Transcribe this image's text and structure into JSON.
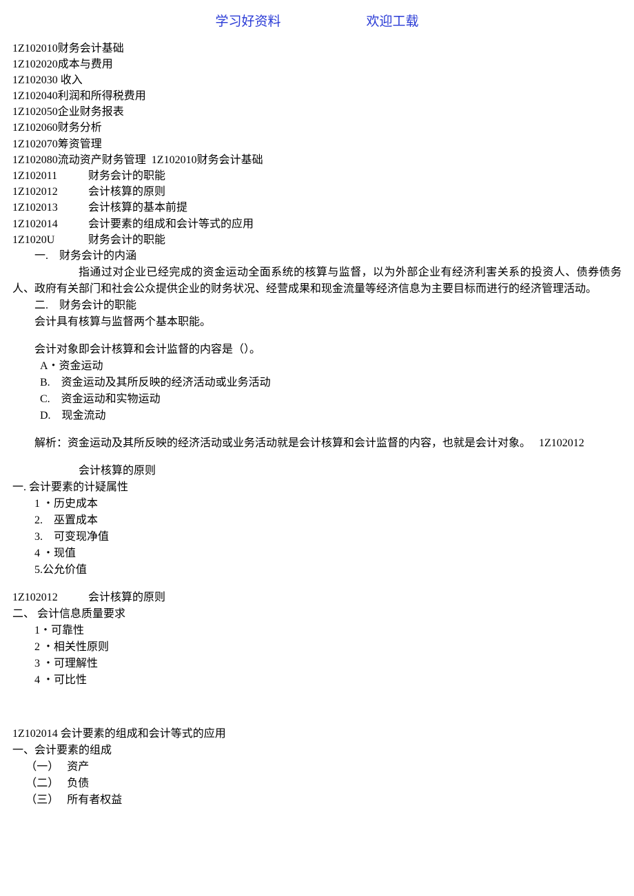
{
  "header": {
    "left": "学习好资料",
    "right": "欢迎工载"
  },
  "toc": [
    {
      "code": "1Z102010",
      "title": "财务会计基础"
    },
    {
      "code": "1Z102020",
      "title": "成本与费用"
    },
    {
      "code": "1Z102030",
      "title": "收入",
      "space": true
    },
    {
      "code": "1Z102040",
      "title": "利润和所得税费用"
    },
    {
      "code": "1Z102050",
      "title": "企业财务报表"
    },
    {
      "code": "1Z102060",
      "title": "财务分析"
    },
    {
      "code": "1Z102070",
      "title": "筹资管理"
    }
  ],
  "toc_last": {
    "code": "1Z102080",
    "title": "流动资产财务管理",
    "extra_code": "1Z102010",
    "extra_title": "财务会计基础"
  },
  "sub": [
    {
      "code": "1Z102011",
      "title": "财务会计的职能"
    },
    {
      "code": "1Z102012",
      "title": "会计核算的原则"
    },
    {
      "code": "1Z102013",
      "title": "会计核算的基本前提"
    },
    {
      "code": "1Z102014",
      "title": "会计要素的组成和会计等式的应用"
    },
    {
      "code": "1Z1020U",
      "title": "财务会计的职能"
    }
  ],
  "section1": {
    "h1": "一.　财务会计的内涵",
    "para": "指通过对企业已经完成的资金运动全面系统的核算与监督，以为外部企业有经济利害关系的投资人、债券债务人、政府有关部门和社会公众提供企业的财务状况、经营成果和现金流量等经济信息为主要目标而进行的经济管理活动。",
    "h2": "二.　财务会计的职能",
    "line": "会计具有核算与监督两个基本职能。"
  },
  "question": {
    "stem": "会计对象即会计核算和会计监督的内容是（）。",
    "opts": [
      "A・资金运动",
      "B.　资金运动及其所反映的经济活动或业务活动",
      "C.　资金运动和实物运动",
      "D.　现金流动"
    ],
    "analysis": "解析：资金运动及其所反映的经济活动或业务活动就是会计核算和会计监督的内容，也就是会计对象。",
    "analysis_code": "1Z102012"
  },
  "principle": {
    "title": "会计核算的原则",
    "h": "一.  会计要素的计疑属性",
    "items": [
      "1 ・历史成本",
      "2.　巫置成本",
      "3.　可变现净值",
      "4 ・现值",
      "5.公允价值"
    ]
  },
  "principle2": {
    "code": "1Z102012",
    "title": "会计核算的原则",
    "h": "二、 会计信息质量要求",
    "items": [
      "1・可靠性",
      "2 ・相关性原则",
      "3 ・可理解性",
      "4 ・可比性"
    ]
  },
  "section14": {
    "head": "1Z102014 会计要素的组成和会计等式的应用",
    "h": "一、会计要素的组成",
    "items": [
      "（一）　 资产",
      "（二）　 负债",
      "（三）　 所有者权益"
    ]
  }
}
